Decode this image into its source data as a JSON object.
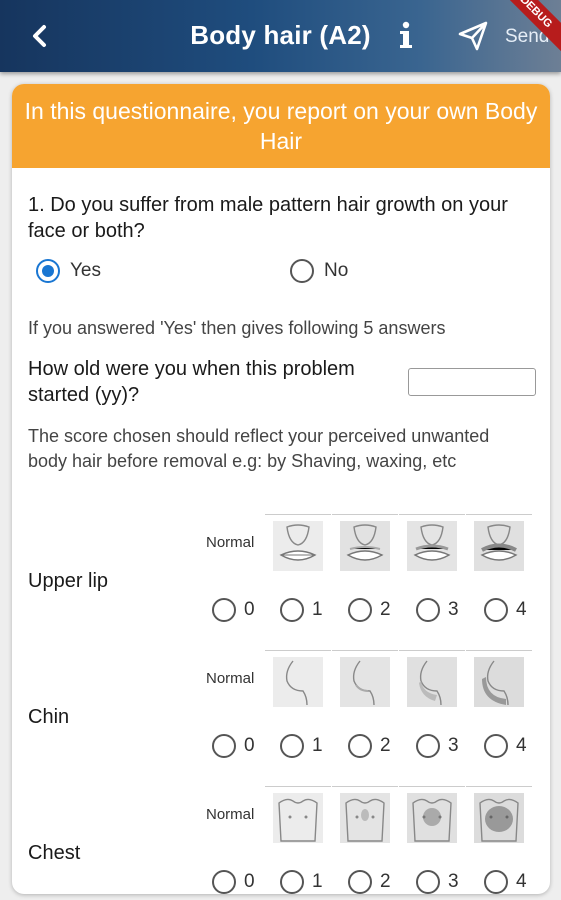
{
  "appbar": {
    "back_icon": "back-chevron-icon",
    "title": "Body hair (A2)",
    "info_icon": "info-icon",
    "send_icon": "paper-plane-icon",
    "send_label": "Send",
    "debug_badge": "DEBUG",
    "color_start": "#16355e",
    "color_end": "#6d7f95"
  },
  "banner": {
    "text": "In this questionnaire, you report on your own Body Hair",
    "color": "#f6a430"
  },
  "question1": {
    "text": "1. Do you suffer from male pattern hair growth on your face or both?",
    "options": [
      {
        "label": "Yes",
        "selected": true
      },
      {
        "label": "No",
        "selected": false
      }
    ]
  },
  "followup_hint": "If you answered 'Yes' then gives following 5 answers",
  "age_question": {
    "text": "How old were you when this problem started (yy)?",
    "value": ""
  },
  "score_note": "The score chosen should reflect your perceived unwanted body hair before removal e.g: by Shaving, waxing, etc",
  "scales": [
    {
      "label": "Upper lip",
      "normal_label": "Normal",
      "scores": [
        "0",
        "1",
        "2",
        "3",
        "4"
      ]
    },
    {
      "label": "Chin",
      "normal_label": "Normal",
      "scores": [
        "0",
        "1",
        "2",
        "3",
        "4"
      ]
    },
    {
      "label": "Chest",
      "normal_label": "Normal",
      "scores": [
        "0",
        "1",
        "2",
        "3",
        "4"
      ]
    }
  ]
}
